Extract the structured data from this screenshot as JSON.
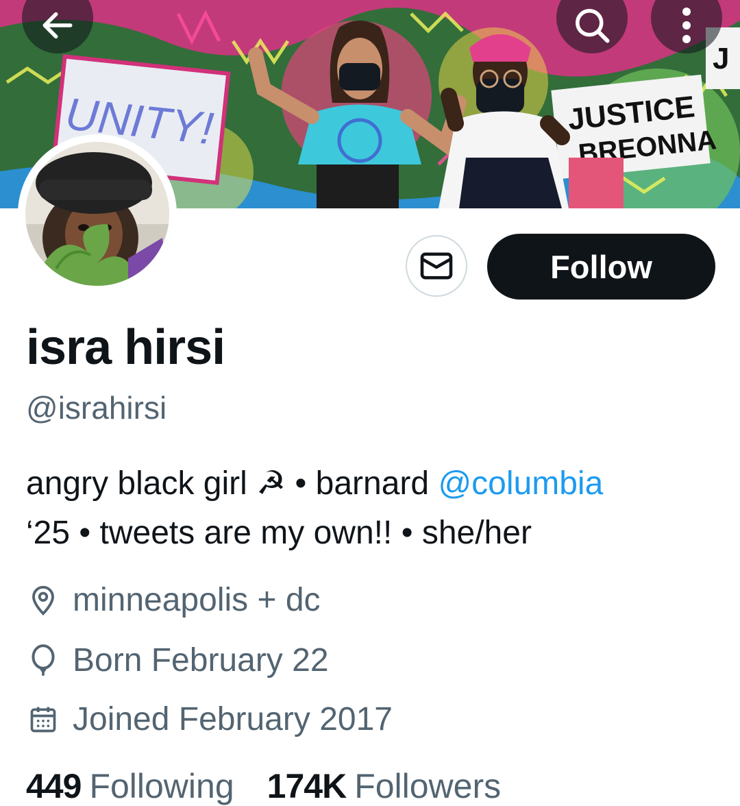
{
  "banner": {
    "mural_texts": [
      "UNITY!",
      "JUSTICE",
      "BREONNA",
      "J"
    ]
  },
  "profile": {
    "display_name": "isra hirsi",
    "handle": "@israhirsi",
    "follow_label": "Follow",
    "bio": {
      "part1": "angry black girl ☭ • barnard ",
      "mention": "@columbia",
      "part2": "‘25 • tweets are my own!! • she/her"
    },
    "location": "minneapolis + dc",
    "birthday": "Born February 22",
    "joined": "Joined February 2017",
    "stats": {
      "following_count": "449",
      "following_label": "Following",
      "followers_count": "174K",
      "followers_label": "Followers"
    }
  },
  "icons": {
    "back": "arrow-left-icon",
    "search": "search-icon",
    "more": "more-vertical-icon",
    "message": "envelope-icon",
    "location": "location-pin-icon",
    "birthday": "balloon-icon",
    "joined": "calendar-icon"
  },
  "colors": {
    "accent": "#1d9bf0",
    "text_primary": "#0f1419",
    "text_secondary": "#536471",
    "follow_bg": "#0f1419"
  }
}
